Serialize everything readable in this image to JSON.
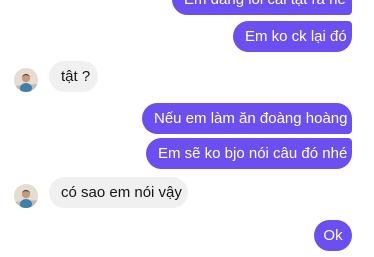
{
  "conversation": {
    "messages": [
      {
        "sender": "me",
        "text": "Em đang lỗi cái tật ra hề"
      },
      {
        "sender": "me",
        "text": "Em ko ck lại đó"
      },
      {
        "sender": "them",
        "text": "tật ?"
      },
      {
        "sender": "me",
        "text": "Nếu em làm ăn đoàng hoàng"
      },
      {
        "sender": "me",
        "text": "Em sẽ ko bjo nói câu đó nhé"
      },
      {
        "sender": "them",
        "text": "có sao em nói vậy"
      },
      {
        "sender": "me",
        "text": "Ok"
      }
    ]
  },
  "colors": {
    "outgoing_bubble": "#6b4ff0",
    "incoming_bubble": "#f0f0f1",
    "background": "#ffffff"
  },
  "icons": {
    "avatar": "contact-avatar-photo"
  }
}
